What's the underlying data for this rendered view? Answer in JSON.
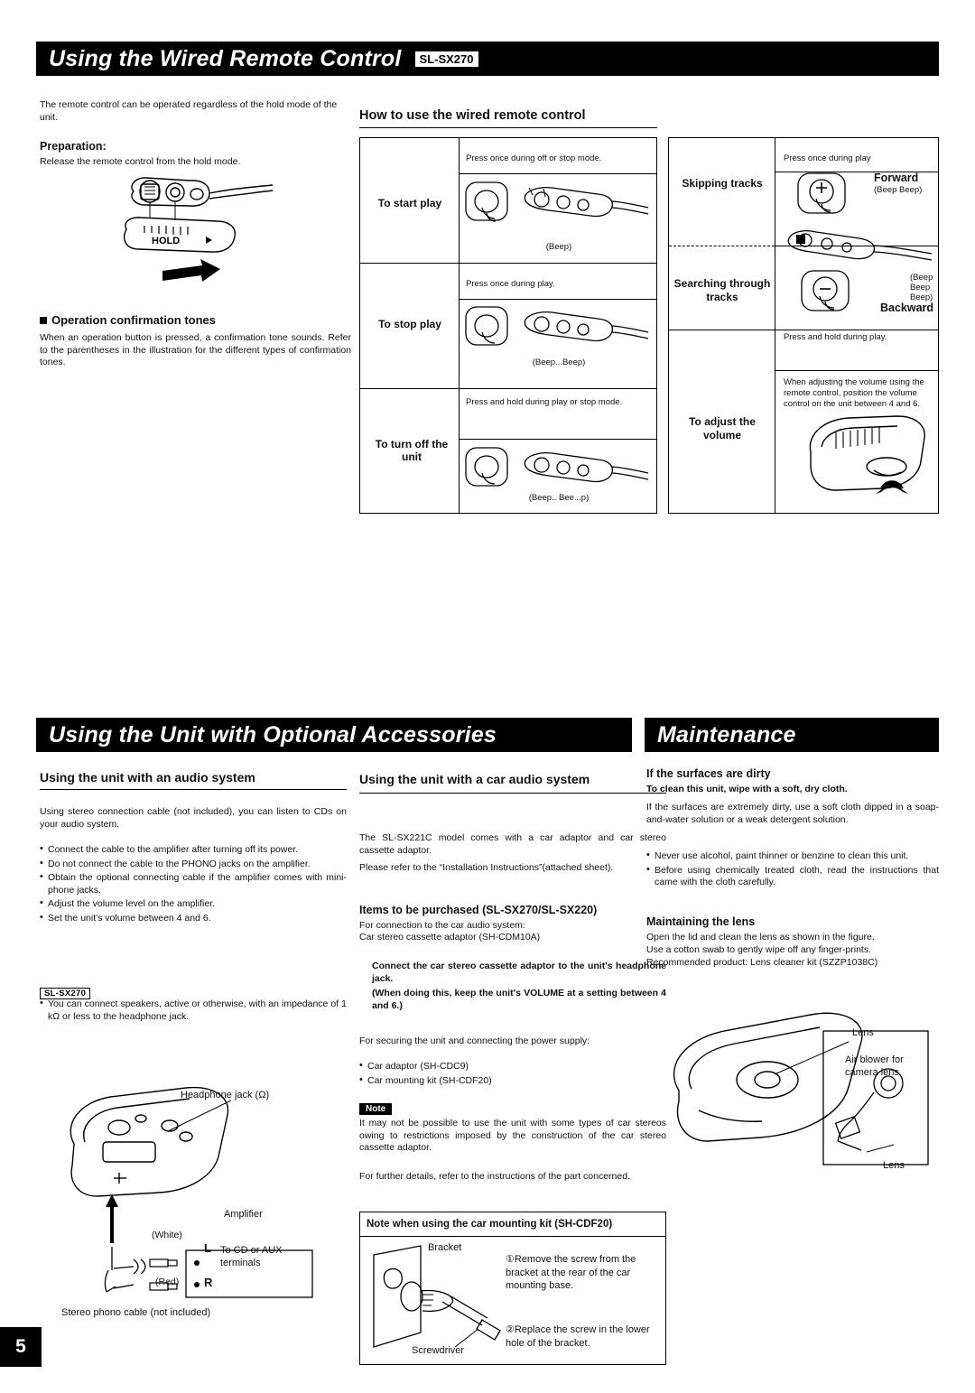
{
  "page": {
    "number": "5"
  },
  "section1": {
    "title": "Using the Wired Remote Control",
    "model_chip": "SL-SX270",
    "intro": "The remote control can be operated regardless of the hold mode of the unit.",
    "preparation_heading": "Preparation:",
    "preparation_text": "Release the remote control from the hold mode.",
    "hold_label": "HOLD",
    "tones_heading": "Operation confirmation tones",
    "tones_text": "When an operation button is pressed, a confirmation tone sounds. Refer to the parentheses in the illustration for the different types of confirmation tones.",
    "how_to_heading": "How to use the wired remote control",
    "rows": [
      {
        "label": "To start play",
        "instruction": "Press once during off or stop mode.",
        "beep": "(Beep)"
      },
      {
        "label": "To stop play",
        "instruction": "Press once during play.",
        "beep": "(Beep...Beep)"
      },
      {
        "label": "To turn off the unit",
        "instruction": "Press and hold during play or stop mode.",
        "beep": "(Beep.. Bee...p)"
      }
    ],
    "right_rows": [
      {
        "label": "Skipping tracks",
        "instruction": "Press once during play",
        "dir_label": "Forward",
        "beep": "(Beep Beep)"
      },
      {
        "label": "Searching through tracks",
        "instruction": "Press and hold during play.",
        "dir_label": "Backward",
        "beep": "(Beep Beep Beep)"
      },
      {
        "label": "To adjust the volume",
        "instruction": "When adjusting the volume using the remote control, position the volume control on the unit between 4 and 6."
      }
    ]
  },
  "section2": {
    "title": "Using the Unit with Optional Accessories",
    "col1": {
      "heading": "Using the unit with an audio system",
      "para": "Using stereo connection cable (not included), you can listen to CDs on your audio system.",
      "bullets": [
        "Connect the cable to the amplifier after turning off its power.",
        "Do not connect the cable to the PHONO jacks on the amplifier.",
        "Obtain the optional connecting cable if the amplifier comes with mini-phone jacks.",
        "Adjust the volume level on the amplifier.",
        "Set the unit's volume between 4 and 6."
      ],
      "chip": "SL-SX270",
      "chip_bullet": "You can connect speakers, active or otherwise, with an impedance of 1 kΩ or less to the headphone jack.",
      "fig_headphone": "Headphone jack (Ω)",
      "fig_amplifier": "Amplifier",
      "fig_white": "(White)",
      "fig_red": "(Red)",
      "fig_l": "L",
      "fig_r": "R",
      "fig_terminals": "To CD or AUX terminals",
      "fig_cable": "Stereo phono cable (not included)"
    },
    "col2": {
      "heading": "Using the unit with a car audio system",
      "para1": "The SL-SX221C model comes with a car adaptor and car stereo cassette adaptor.",
      "para2": "Please refer to the “Installation Instructions”(attached sheet).",
      "items_heading": "Items to be purchased (SL-SX270/SL-SX220)",
      "items_sub": "For connection to the car audio system:",
      "items_line": "Car stereo cassette adaptor (SH-CDM10A)",
      "bold1": "Connect the car stereo cassette adaptor to the unit's headphone jack.",
      "bold2": "(When doing this, keep the unit's VOLUME at a setting between 4 and 6.)",
      "secure": "For securing the unit and connecting the power supply:",
      "secure_bullets": [
        "Car adaptor (SH-CDC9)",
        "Car mounting kit (SH-CDF20)"
      ],
      "note_chip": "Note",
      "note_text": "It may not be possible to use the unit with some types of car stereos owing to restrictions imposed by the construction of the car stereo cassette adaptor.",
      "further": "For further details, refer to the instructions of the part concerned.",
      "mount_box_heading": "Note when using the car mounting kit (SH-CDF20)",
      "mount_bracket": "Bracket",
      "mount_screwdriver": "Screwdriver",
      "mount_step1": "①Remove the screw from the bracket at the rear of the car mounting base.",
      "mount_step2": "②Replace the screw in the lower hole of the bracket."
    }
  },
  "section3": {
    "title": "Maintenance",
    "dirty_heading": "If the surfaces are dirty",
    "dirty_bold": "To clean this unit, wipe with a soft, dry cloth.",
    "dirty_text": "If the surfaces are extremely dirty, use a soft cloth dipped in a soap-and-water solution or a weak detergent solution.",
    "bullets": [
      "Never use alcohol, paint thinner or benzine to clean this unit.",
      "Before using chemically treated cloth, read the instructions that came with the cloth carefully."
    ],
    "lens_heading": "Maintaining the lens",
    "lens_text1": "Open the lid and clean the lens as shown in the figure.",
    "lens_text2": "Use a cotton swab to gently wipe off any finger-prints.",
    "lens_text3": "Recommended product: Lens cleaner kit (SZZP1038C)",
    "fig_lens": "Lens",
    "fig_blower": "Air blower for camera lens",
    "fig_lens2": "Lens"
  }
}
